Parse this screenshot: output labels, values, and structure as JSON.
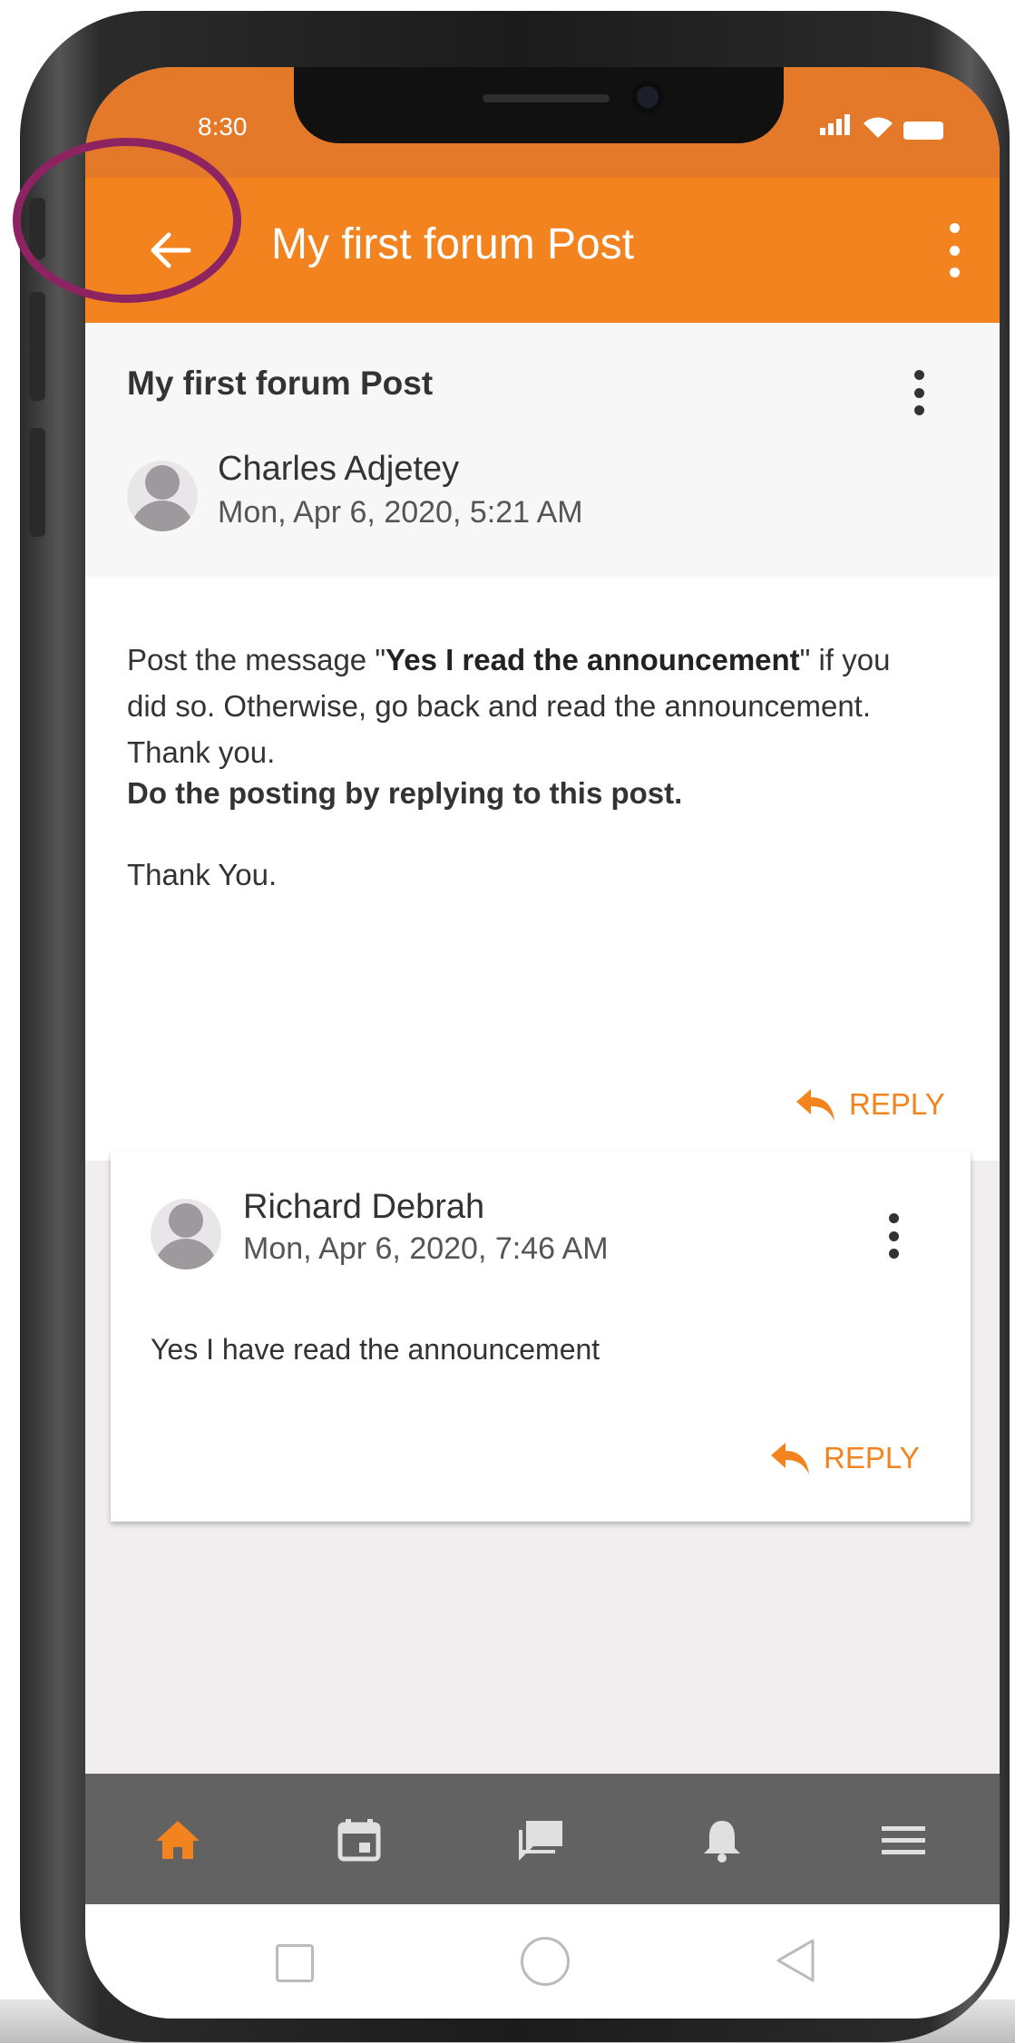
{
  "status_bar": {
    "time": "8:30"
  },
  "app_bar": {
    "title": "My first forum Post"
  },
  "post": {
    "title": "My first forum Post",
    "author": "Charles Adjetey",
    "date": "Mon, Apr 6, 2020, 5:21 AM",
    "body_part1": "Post the message \"",
    "body_bold": "Yes I read the announcement",
    "body_part2": "\" if you did so. Otherwise, go back and read the announcement. Thank you.",
    "instruction": "Do the posting by replying to this post.",
    "closing": "Thank You.",
    "reply_label": "REPLY"
  },
  "reply_post": {
    "author": "Richard Debrah",
    "date": "Mon, Apr 6, 2020, 7:46 AM",
    "text": "Yes I have read the announcement",
    "reply_label": "REPLY"
  },
  "bottom_nav": {
    "items": [
      {
        "icon": "home-icon",
        "active": true
      },
      {
        "icon": "calendar-icon",
        "active": false
      },
      {
        "icon": "forum-icon",
        "active": false
      },
      {
        "icon": "bell-icon",
        "active": false
      },
      {
        "icon": "menu-icon",
        "active": false
      }
    ]
  },
  "colors": {
    "accent": "#f3831f",
    "status_bar": "#e5792a",
    "highlight": "#8e2362",
    "nav_bg": "#636262"
  }
}
